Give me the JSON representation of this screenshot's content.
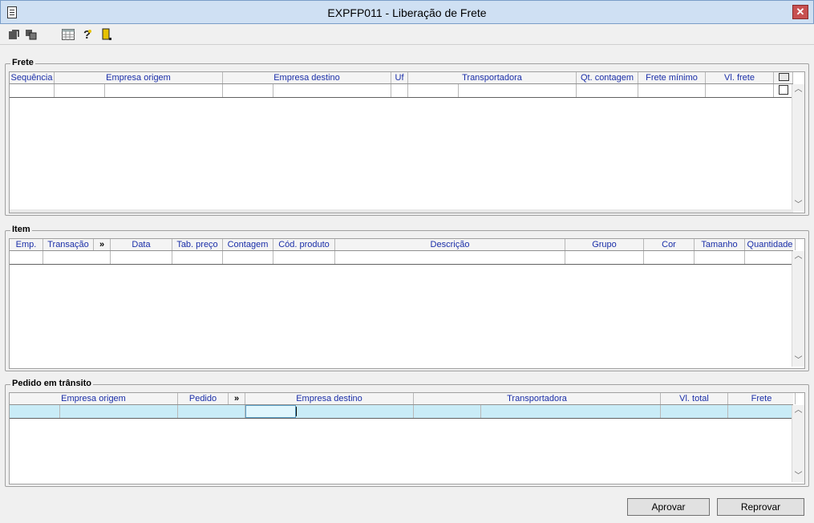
{
  "window": {
    "title": "EXPFP011 - Liberação de Frete",
    "close_label": "✕"
  },
  "toolbar": {
    "buttons": [
      {
        "name": "export-icon"
      },
      {
        "name": "copy-icon"
      },
      {
        "name": "table-icon"
      },
      {
        "name": "help-icon"
      },
      {
        "name": "exit-door-icon"
      }
    ]
  },
  "frete": {
    "title": "Frete",
    "columns": [
      "Sequência",
      "Empresa origem",
      "Empresa destino",
      "Uf",
      "Transportadora",
      "Qt. contagem",
      "Frete mínimo",
      "Vl. frete"
    ]
  },
  "item": {
    "title": "Item",
    "columns": [
      "Emp.",
      "Transação",
      "»",
      "Data",
      "Tab. preço",
      "Contagem",
      "Cód. produto",
      "Descrição",
      "Grupo",
      "Cor",
      "Tamanho",
      "Quantidade"
    ]
  },
  "pedido": {
    "title": "Pedido em trânsito",
    "columns": [
      "Empresa origem",
      "Pedido",
      "»",
      "Empresa destino",
      "Transportadora",
      "Vl. total",
      "Frete"
    ]
  },
  "buttons": {
    "approve": "Aprovar",
    "reject": "Reprovar"
  },
  "colors": {
    "selected_row": "#c9ecf7",
    "header_text": "#1a2ea8",
    "title_bar": "#cfe0f3",
    "close": "#c75050"
  }
}
